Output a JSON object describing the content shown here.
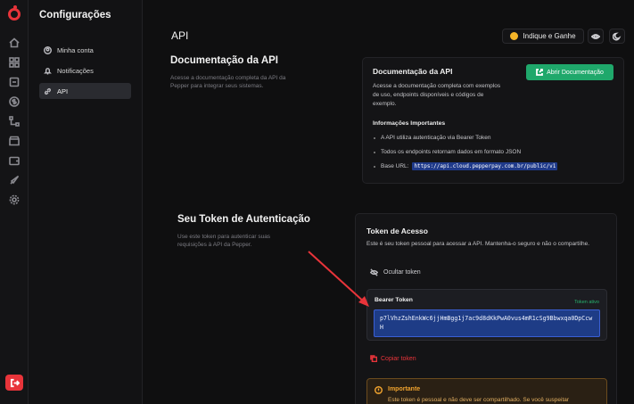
{
  "sidebar": {
    "title": "Configurações",
    "items": [
      {
        "label": "Minha conta",
        "icon": "user-icon"
      },
      {
        "label": "Notificações",
        "icon": "bell-icon"
      },
      {
        "label": "API",
        "icon": "link-icon"
      }
    ]
  },
  "rail_icons": [
    "home-icon",
    "users-icon",
    "box-icon",
    "dollar-icon",
    "flow-icon",
    "store-icon",
    "wallet-icon",
    "rocket-icon",
    "gear-icon"
  ],
  "header": {
    "title": "API",
    "refer_label": "Indique e Ganhe"
  },
  "docs": {
    "heading": "Documentação da API",
    "description": "Acesse a documentação completa da API da Pepper para integrar seus sistemas.",
    "card": {
      "title": "Documentação da API",
      "text": "Acesse a documentação completa com exemplos de uso, endpoints disponíveis e códigos de exemplo.",
      "button": "Abrir Documentação",
      "info_title": "Informações Importantes",
      "bullets": [
        "A API utiliza autenticação via Bearer Token",
        "Todos os endpoints retornam dados em formato JSON"
      ],
      "base_url_label": "Base URL:",
      "base_url": "https://api.cloud.pepperpay.com.br/public/v1"
    }
  },
  "token": {
    "heading": "Seu Token de Autenticação",
    "description": "Use este token para autenticar suas requisições à API da Pepper.",
    "card": {
      "title": "Token de Acesso",
      "text": "Este é seu token pessoal para acessar a API. Mantenha-o seguro e não o compartilhe.",
      "hide_label": "Ocultar token",
      "bearer_label": "Bearer Token",
      "status": "Token ativo",
      "value": "p7lVhzZshEnkWc6jjHmBgg1j7ac9d8dKkPwA0vus4mR1cSg9Bbwxqa0DpCcwH",
      "copy_label": "Copiar token",
      "warning_title": "Importante",
      "warning_text": "Este token é pessoal e não deve ser compartilhado. Se você suspeitar"
    }
  },
  "colors": {
    "accent_red": "#e8343a",
    "accent_green": "#1fa86b",
    "token_bg": "#1e3c86",
    "warning": "#f0a32e"
  }
}
